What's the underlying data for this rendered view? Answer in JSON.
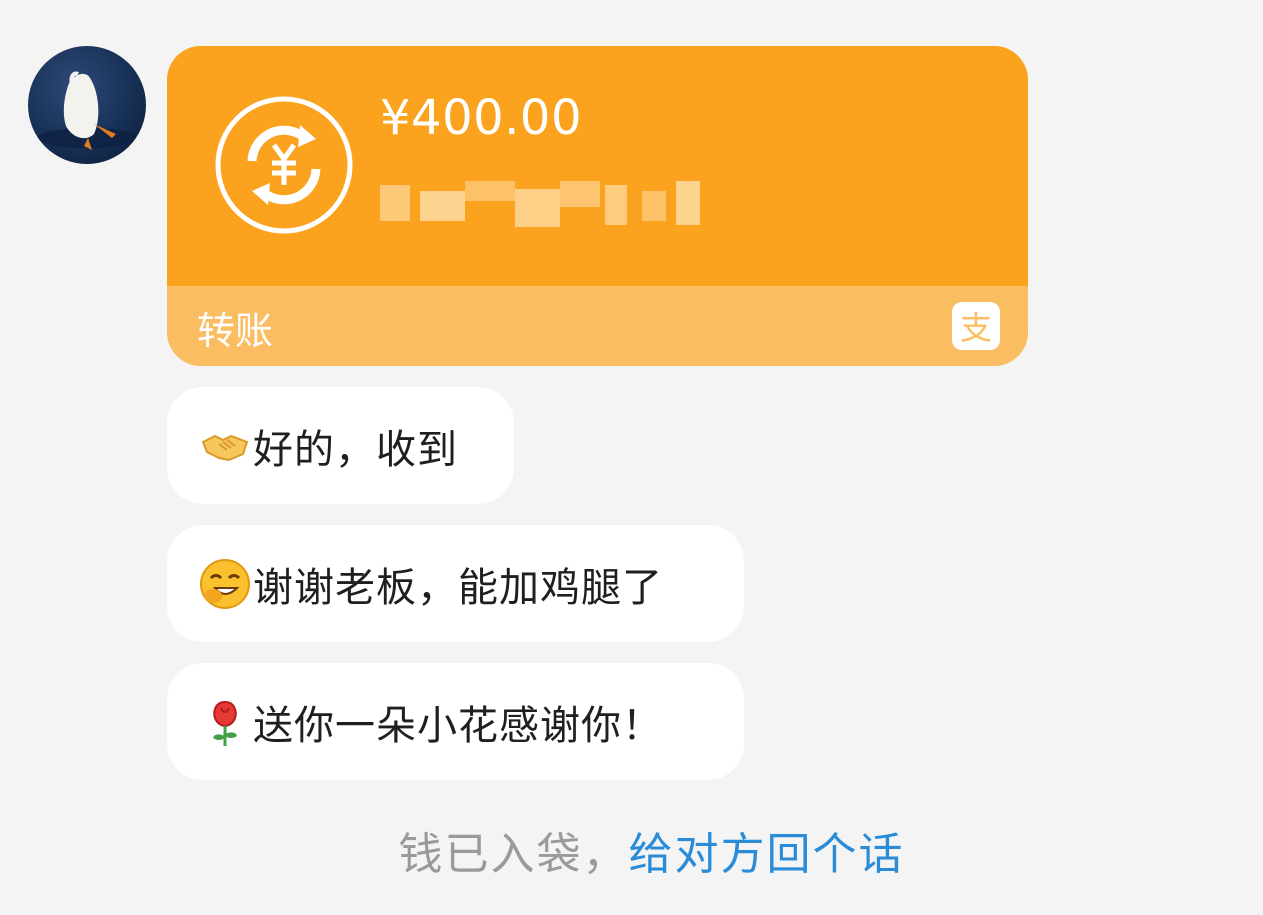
{
  "avatar": {
    "icon": "duck-avatar-icon"
  },
  "transfer": {
    "amount": "¥400.00",
    "label": "转账",
    "icon": "yuan-exchange-icon",
    "brand_icon": "alipay-icon",
    "accent_color": "#fba31f",
    "footer_color": "#fbbd62"
  },
  "messages": [
    {
      "emoji": "handshake-icon",
      "text": "好的，收到"
    },
    {
      "emoji": "grinning-hand-over-mouth-icon",
      "text": "谢谢老板，能加鸡腿了"
    },
    {
      "emoji": "rose-icon",
      "text": "送你一朵小花感谢你！"
    }
  ],
  "notice": {
    "prefix": "钱已入袋，",
    "link": "给对方回个话",
    "link_color": "#2a8bd6"
  }
}
